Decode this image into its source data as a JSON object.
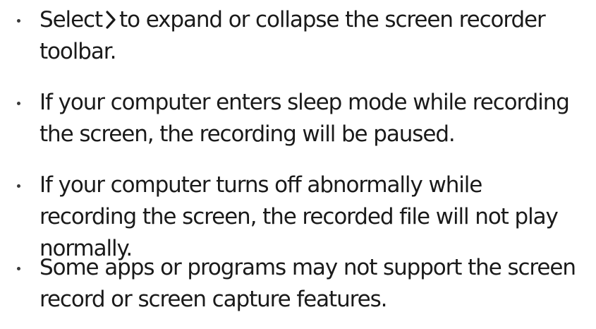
{
  "bullets": [
    {
      "lines": [
        "to expand or collapse the screen recorder",
        "toolbar."
      ],
      "prefix": "Select"
    },
    {
      "lines": [
        "If your computer enters sleep mode while recording",
        "the screen, the recording will be paused."
      ]
    },
    {
      "lines": [
        "If your computer turns off abnormally while",
        "recording the screen, the recorded file will not play",
        "normally."
      ]
    },
    {
      "lines": [
        "Some apps or programs may not support the screen",
        "record or screen capture features."
      ]
    }
  ],
  "icons": {
    "expand": "chevron-right-icon"
  }
}
